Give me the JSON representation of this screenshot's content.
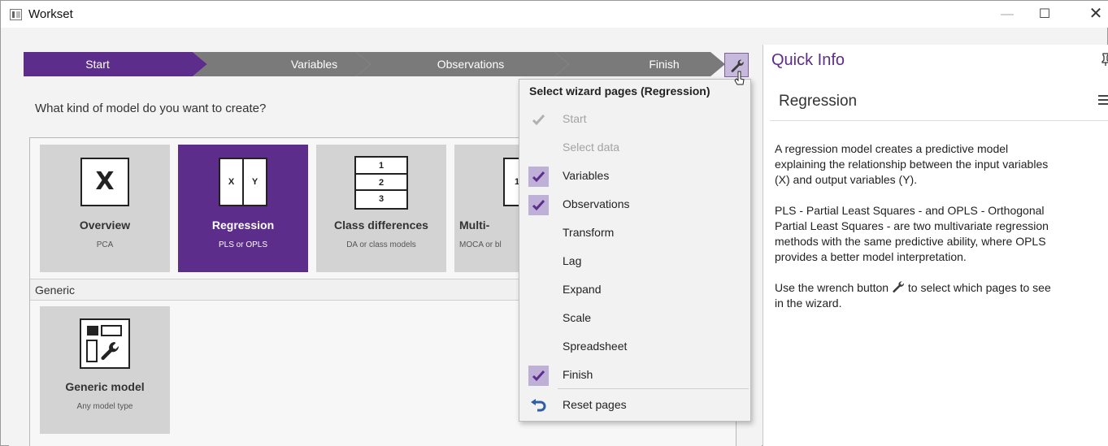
{
  "window": {
    "title": "Workset",
    "minimize_glyph": "—",
    "maximize_glyph": "☐",
    "close_glyph": "✕"
  },
  "wizard": {
    "steps": [
      {
        "label": "Start",
        "active": true
      },
      {
        "label": "Variables",
        "active": false
      },
      {
        "label": "Observations",
        "active": false
      },
      {
        "label": "Finish",
        "active": false
      }
    ],
    "settings_icon": "wrench-icon"
  },
  "main": {
    "question": "What kind of model do you want to create?",
    "tiles": [
      {
        "title": "Overview",
        "subtitle": "PCA",
        "icon": "x-matrix-icon",
        "icon_text": "X",
        "selected": false
      },
      {
        "title": "Regression",
        "subtitle": "PLS or OPLS",
        "icon": "xy-matrix-icon",
        "icon_text_left": "X",
        "icon_text_right": "Y",
        "selected": true
      },
      {
        "title": "Class differences",
        "subtitle": "DA or class models",
        "icon": "class-blocks-icon",
        "icon_rows": [
          "1",
          "2",
          "3"
        ],
        "selected": false
      },
      {
        "title": "Multi-",
        "subtitle": "MOCA or bl",
        "icon": "multiblock-icon",
        "icon_text": "1 :",
        "selected": false
      }
    ],
    "generic_section": {
      "label": "Generic",
      "tile": {
        "title": "Generic model",
        "subtitle": "Any model type",
        "icon": "generic-model-icon"
      }
    }
  },
  "dropdown": {
    "header": "Select wizard pages (Regression)",
    "items": [
      {
        "label": "Start",
        "checked": true,
        "enabled": false
      },
      {
        "label": "Select data",
        "checked": false,
        "enabled": false
      },
      {
        "label": "Variables",
        "checked": true,
        "enabled": true
      },
      {
        "label": "Observations",
        "checked": true,
        "enabled": true
      },
      {
        "label": "Transform",
        "checked": false,
        "enabled": true
      },
      {
        "label": "Lag",
        "checked": false,
        "enabled": true
      },
      {
        "label": "Expand",
        "checked": false,
        "enabled": true
      },
      {
        "label": "Scale",
        "checked": false,
        "enabled": true
      },
      {
        "label": "Spreadsheet",
        "checked": false,
        "enabled": true
      },
      {
        "label": "Finish",
        "checked": true,
        "enabled": true
      }
    ],
    "reset_label": "Reset pages",
    "reset_icon": "undo-icon"
  },
  "quick_info": {
    "title": "Quick Info",
    "pin_icon": "pin-icon",
    "heading": "Regression",
    "menu_icon": "hamburger-menu-icon",
    "para1": "A regression model creates a predictive model\nexplaining the relationship between the input variables\n(X) and output variables (Y).",
    "para2": "PLS - Partial Least Squares - and OPLS - Orthogonal\nPartial Least Squares - are two multivariate regression\nmethods with the same predictive ability, where OPLS\nprovides a better model interpretation.",
    "para3_before": "Use the wrench button ",
    "para3_after": " to select which pages to see\nin the wizard."
  },
  "colors": {
    "accent_purple": "#5c2d8a",
    "check_bg": "#bfb0d8",
    "step_gray": "#7a7a7a",
    "tile_gray": "#d3d3d3"
  }
}
